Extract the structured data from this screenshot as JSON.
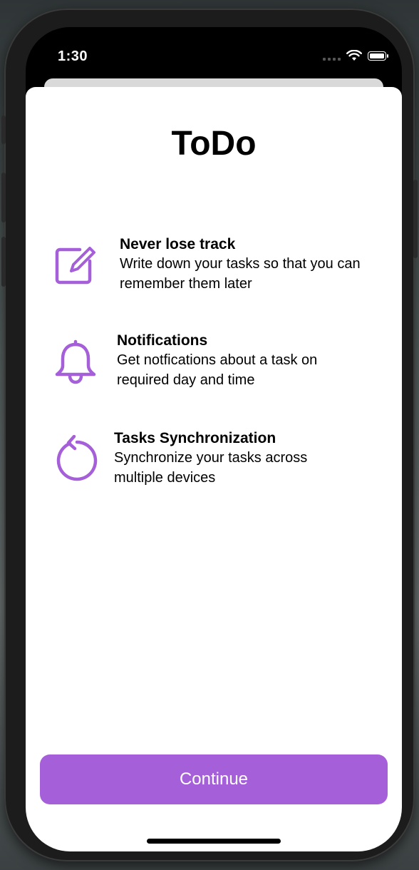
{
  "status_bar": {
    "time": "1:30"
  },
  "app": {
    "title": "ToDo"
  },
  "features": [
    {
      "icon": "compose-icon",
      "title": "Never lose track",
      "description": "Write down your tasks so that you can remember them later"
    },
    {
      "icon": "bell-icon",
      "title": "Notifications",
      "description": "Get notfications about a task on required day and time"
    },
    {
      "icon": "sync-icon",
      "title": "Tasks Synchronization",
      "description": "Synchronize your tasks across multiple devices"
    }
  ],
  "continue_button": {
    "label": "Continue"
  },
  "colors": {
    "accent": "#a45fd9",
    "background": "#ffffff",
    "text": "#000000"
  }
}
